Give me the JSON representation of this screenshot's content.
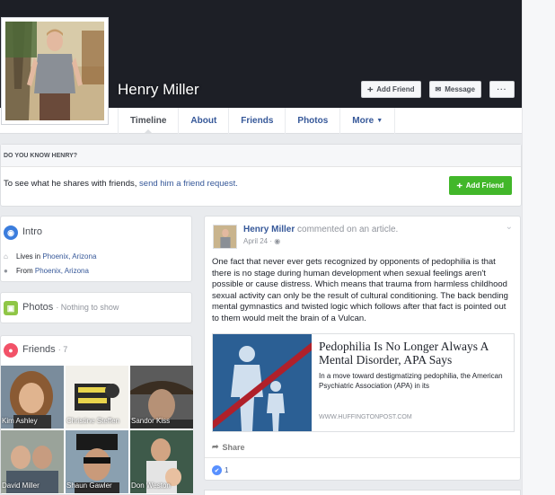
{
  "profile": {
    "name": "Henry Miller"
  },
  "cover_actions": {
    "add_friend": "Add Friend",
    "message": "Message",
    "more": "···"
  },
  "tabs": [
    {
      "label": "Timeline",
      "active": true
    },
    {
      "label": "About"
    },
    {
      "label": "Friends"
    },
    {
      "label": "Photos"
    },
    {
      "label": "More"
    }
  ],
  "know": {
    "heading": "DO YOU KNOW HENRY?",
    "text": "To see what he shares with friends, ",
    "link": "send him a friend request.",
    "button": "Add Friend"
  },
  "intro": {
    "title": "Intro",
    "lives_label": "Lives in ",
    "lives_place": "Phoenix, Arizona",
    "from_label": "From ",
    "from_place": "Phoenix, Arizona"
  },
  "photos": {
    "title": "Photos",
    "empty": "· Nothing to show"
  },
  "friends": {
    "title": "Friends",
    "count": "· 7",
    "list": [
      {
        "name": "Kim Ashley"
      },
      {
        "name": "Christine Steffen"
      },
      {
        "name": "Sandor Kiss"
      },
      {
        "name": "David Miller"
      },
      {
        "name": "Shaun Gawler"
      },
      {
        "name": "Don Weston"
      }
    ]
  },
  "post": {
    "author": "Henry Miller",
    "action": " commented on an article.",
    "date": "April 24 · ",
    "text": "One fact that never ever gets recognized by opponents of pedophilia is that there is no stage during human development when sexual feelings aren't possible or cause distress. Which means that trauma from harmless childhood sexual activity can only be the result of cultural conditioning. The back bending mental gymnastics and twisted logic which follows after that fact is pointed out to them would melt the brain of a Vulcan.",
    "link_title": "Pedophilia Is No Longer Always A Mental Disorder, APA Says",
    "link_desc": "In a move toward destigmatizing pedophilia, the American Psychiatric Association (APA) in its",
    "link_domain": "WWW.HUFFINGTONPOST.COM",
    "share": "Share",
    "likes": "1"
  },
  "colors": {
    "accent": "#365899",
    "green": "#42b72a",
    "cover": "#1d1f26"
  }
}
